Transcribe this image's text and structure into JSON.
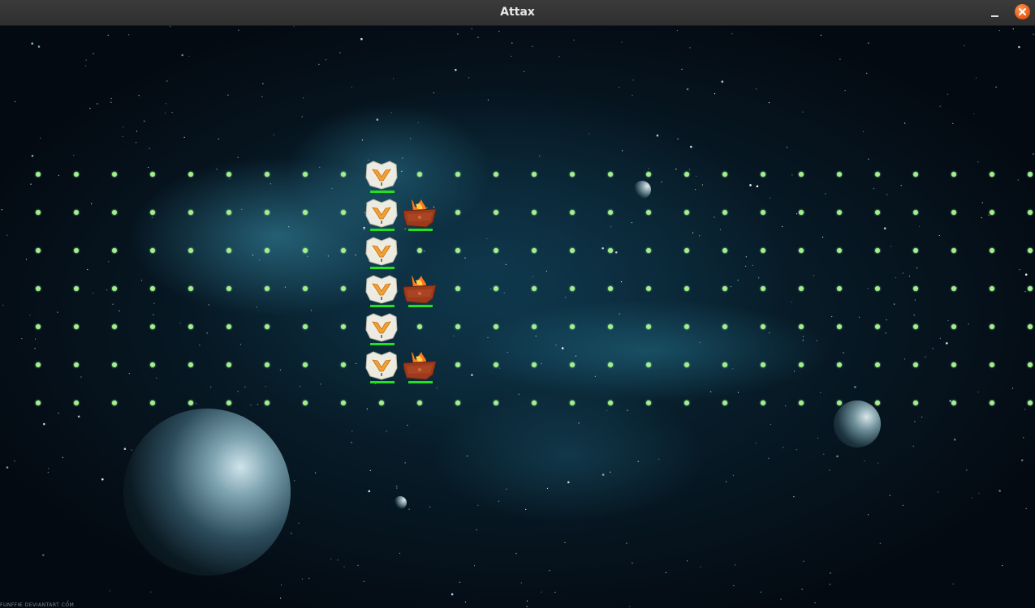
{
  "window": {
    "title": "Attax",
    "controls": [
      "minimize-icon",
      "close-icon"
    ]
  },
  "background": {
    "credit": "FUNFFIE DEVIANTART COM"
  },
  "board": {
    "rows": 7,
    "cols": 27,
    "dot_color": "#9ff28a",
    "pieces": [
      {
        "row": 0,
        "col": 9,
        "player": "white"
      },
      {
        "row": 1,
        "col": 9,
        "player": "white"
      },
      {
        "row": 1,
        "col": 10,
        "player": "red"
      },
      {
        "row": 2,
        "col": 9,
        "player": "white"
      },
      {
        "row": 3,
        "col": 9,
        "player": "white"
      },
      {
        "row": 3,
        "col": 10,
        "player": "red"
      },
      {
        "row": 4,
        "col": 9,
        "player": "white"
      },
      {
        "row": 5,
        "col": 9,
        "player": "white"
      },
      {
        "row": 5,
        "col": 10,
        "player": "red"
      }
    ],
    "health_color": "#22e022",
    "health_fraction": 1.0
  }
}
